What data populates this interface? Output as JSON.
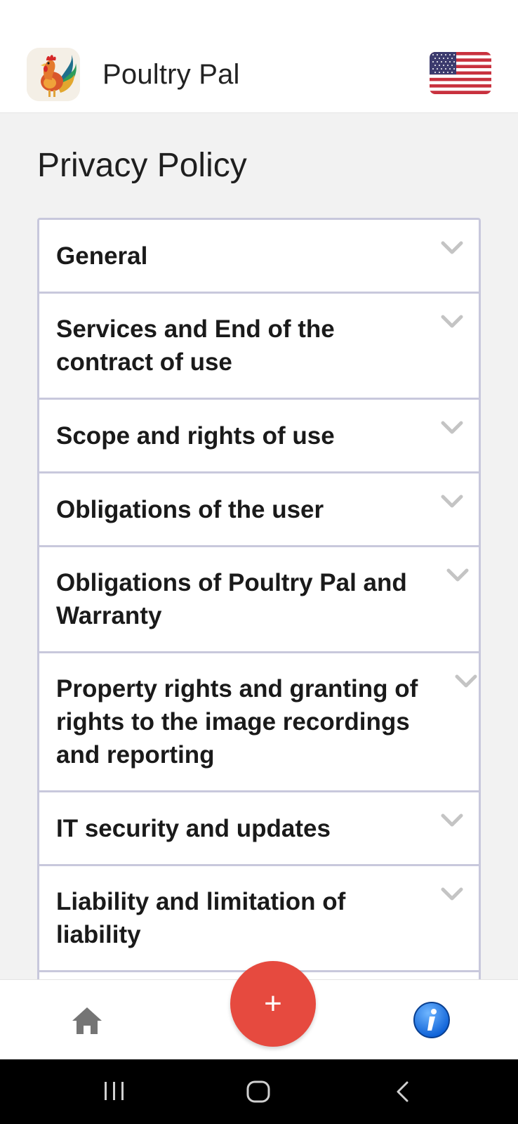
{
  "header": {
    "app_title": "Poultry Pal",
    "logo_icon": "rooster-logo-icon",
    "language_icon": "us-flag-icon"
  },
  "page": {
    "title": "Privacy Policy"
  },
  "accordion": {
    "items": [
      {
        "label": "General"
      },
      {
        "label": "Services and End of the contract of use"
      },
      {
        "label": "Scope and rights of use"
      },
      {
        "label": "Obligations of the user"
      },
      {
        "label": "Obligations of Poultry Pal and Warranty"
      },
      {
        "label": "Property rights and granting of rights to the image recordings and reporting"
      },
      {
        "label": "IT security and updates"
      },
      {
        "label": "Liability and limitation of liability"
      }
    ],
    "expand_icon": "chevron-down-icon"
  },
  "bottom_nav": {
    "home_icon": "home-icon",
    "add_label": "+",
    "info_icon": "info-icon"
  },
  "system_nav": {
    "recents_icon": "recents-icon",
    "home_icon": "home-circle-icon",
    "back_icon": "back-icon"
  },
  "colors": {
    "accent_fab": "#e64a3f",
    "border": "#c8c8dc",
    "background": "#f2f2f2"
  }
}
